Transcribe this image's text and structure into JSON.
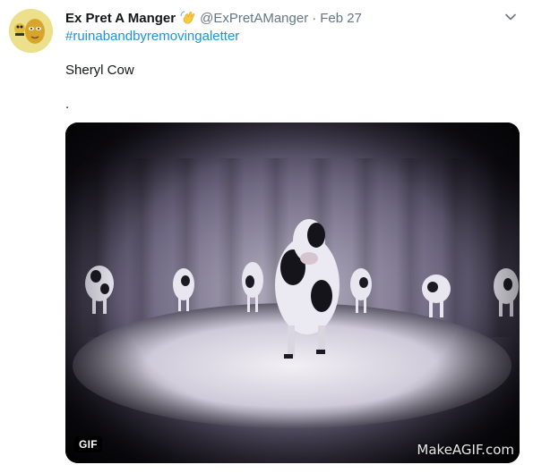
{
  "tweet": {
    "author": {
      "display_name": "Ex Pret A Manger",
      "badge_icon": "waving-hand-emoji",
      "handle": "@ExPretAManger",
      "separator": "·",
      "date": "Feb 27"
    },
    "hashtag": "#ruinabandbyremovingaletter",
    "text_line_1": "Sheryl Cow",
    "text_line_2": ".",
    "media": {
      "type": "gif",
      "badge": "GIF",
      "watermark": "MakeAGIF.com",
      "description_icon": "dancing-cows-gif"
    },
    "menu_icon": "chevron-down-icon",
    "colors": {
      "link": "#1b95e0",
      "secondary_text": "#657786",
      "primary_text": "#14171a"
    }
  }
}
